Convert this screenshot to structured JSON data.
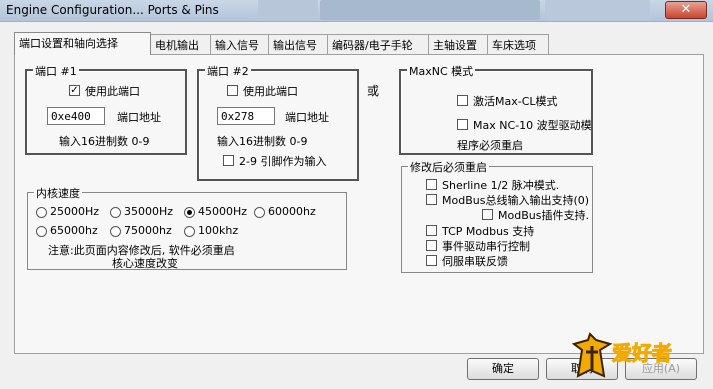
{
  "window": {
    "title": "Engine Configuration... Ports & Pins",
    "close_label": "✕"
  },
  "tabs": [
    {
      "label": "端口设置和轴向选择"
    },
    {
      "label": "电机输出"
    },
    {
      "label": "输入信号"
    },
    {
      "label": "输出信号"
    },
    {
      "label": "编码器/电子手轮"
    },
    {
      "label": "主轴设置"
    },
    {
      "label": "车床选项"
    }
  ],
  "port1": {
    "title": "端口 #1",
    "enable_label": "使用此端口",
    "enable_checked": true,
    "address_value": "0xe400",
    "address_label": "端口地址",
    "hint": "输入16进制数 0-9"
  },
  "port2": {
    "title": "端口 #2",
    "enable_label": "使用此端口",
    "enable_checked": false,
    "address_value": "0x278",
    "address_label": "端口地址",
    "hint": "输入16进制数 0-9",
    "pins_label": "2-9 引脚作为输入",
    "pins_checked": false
  },
  "or_label": "或",
  "maxnc": {
    "title": "MaxNC 模式",
    "activate_label": "激活Max-CL模式",
    "wave_label": "Max NC-10 波型驱动模",
    "note": "程序必须重启"
  },
  "restart": {
    "title": "修改后必须重启",
    "items": [
      {
        "label": "Sherline 1/2 脉冲模式."
      },
      {
        "label": "ModBus总线输入输出支持(0)"
      },
      {
        "label": "ModBus插件支持."
      },
      {
        "label": "TCP Modbus 支持"
      },
      {
        "label": "事件驱动串行控制"
      },
      {
        "label": "伺服串联反馈"
      }
    ]
  },
  "kernel": {
    "title": "内核速度",
    "options": [
      "25000Hz",
      "35000Hz",
      "45000Hz",
      "60000hz",
      "65000hz",
      "75000hz",
      "100khz"
    ],
    "selected": "45000Hz",
    "note_line1": "注意:此页面内容修改后, 软件必须重启",
    "note_line2": "核心速度改变"
  },
  "buttons": {
    "ok": "确定",
    "cancel": "取消",
    "apply": "应用(A)"
  },
  "logo": {
    "text": "爱好者",
    "colors": {
      "primary": "#f2a900",
      "accent": "#c0140c",
      "dark": "#3a2400"
    }
  }
}
